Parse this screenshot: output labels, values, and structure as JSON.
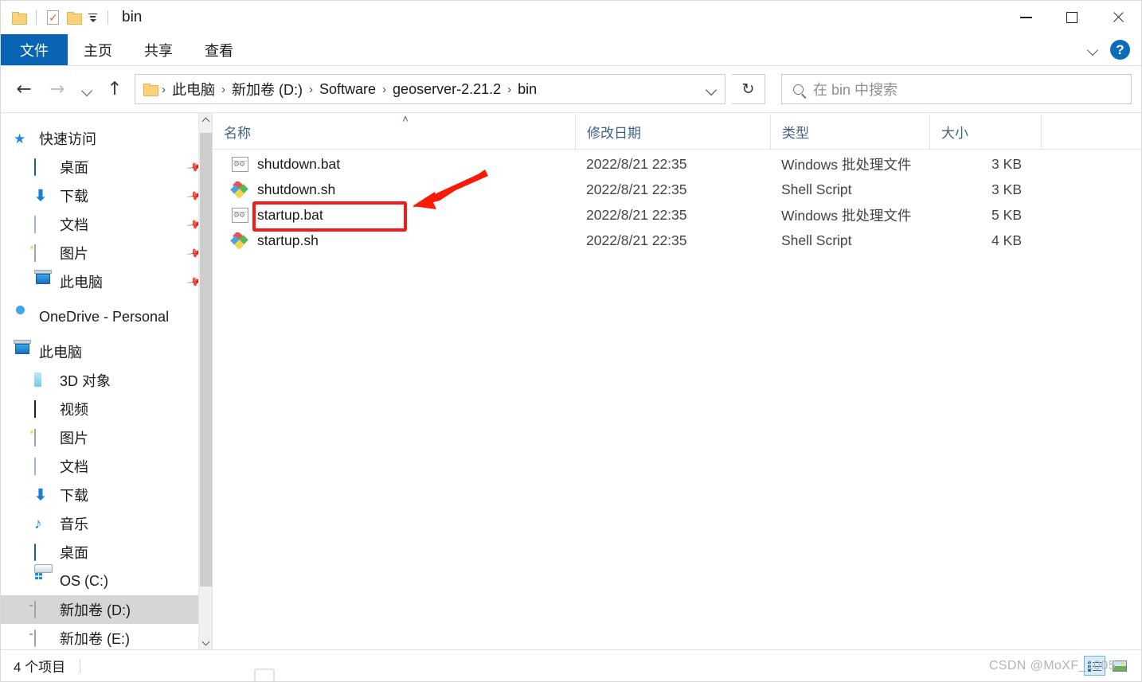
{
  "window": {
    "title": "bin",
    "quick_access_toolbar": [
      "folder-icon",
      "properties-icon",
      "new-folder-icon",
      "customize-dropdown"
    ],
    "controls": {
      "minimize": "—",
      "maximize": "□",
      "close": "✕"
    }
  },
  "ribbon": {
    "tabs": [
      {
        "label": "文件",
        "active": true
      },
      {
        "label": "主页",
        "active": false
      },
      {
        "label": "共享",
        "active": false
      },
      {
        "label": "查看",
        "active": false
      }
    ],
    "expand_label": "chevron-down-icon",
    "help_label": "?"
  },
  "addressbar": {
    "back": "←",
    "forward": "→",
    "recent": "chevron-down-icon",
    "up": "↑",
    "refresh": "↻",
    "breadcrumbs": [
      "此电脑",
      "新加卷 (D:)",
      "Software",
      "geoserver-2.21.2",
      "bin"
    ],
    "separator": "›"
  },
  "search": {
    "placeholder": "在 bin 中搜索",
    "value": ""
  },
  "sidebar": {
    "items": [
      {
        "label": "快速访问",
        "icon": "star-icon",
        "level": "root",
        "pinned": false,
        "selected": false
      },
      {
        "label": "桌面",
        "icon": "desktop-icon",
        "level": "child",
        "pinned": true,
        "selected": false
      },
      {
        "label": "下载",
        "icon": "downloads-icon",
        "level": "child",
        "pinned": true,
        "selected": false
      },
      {
        "label": "文档",
        "icon": "documents-icon",
        "level": "child",
        "pinned": true,
        "selected": false
      },
      {
        "label": "图片",
        "icon": "pictures-icon",
        "level": "child",
        "pinned": true,
        "selected": false
      },
      {
        "label": "此电脑",
        "icon": "this-pc-icon",
        "level": "child",
        "pinned": true,
        "selected": false
      },
      {
        "label": "OneDrive - Personal",
        "icon": "onedrive-icon",
        "level": "root",
        "pinned": false,
        "selected": false
      },
      {
        "label": "此电脑",
        "icon": "this-pc-icon",
        "level": "root",
        "pinned": false,
        "selected": false
      },
      {
        "label": "3D 对象",
        "icon": "3d-objects-icon",
        "level": "child",
        "pinned": false,
        "selected": false
      },
      {
        "label": "视频",
        "icon": "videos-icon",
        "level": "child",
        "pinned": false,
        "selected": false
      },
      {
        "label": "图片",
        "icon": "pictures-icon",
        "level": "child",
        "pinned": false,
        "selected": false
      },
      {
        "label": "文档",
        "icon": "documents-icon",
        "level": "child",
        "pinned": false,
        "selected": false
      },
      {
        "label": "下载",
        "icon": "downloads-icon",
        "level": "child",
        "pinned": false,
        "selected": false
      },
      {
        "label": "音乐",
        "icon": "music-icon",
        "level": "child",
        "pinned": false,
        "selected": false
      },
      {
        "label": "桌面",
        "icon": "desktop-icon",
        "level": "child",
        "pinned": false,
        "selected": false
      },
      {
        "label": "OS (C:)",
        "icon": "os-drive-icon",
        "level": "child",
        "pinned": false,
        "selected": false
      },
      {
        "label": "新加卷 (D:)",
        "icon": "drive-icon",
        "level": "child",
        "pinned": false,
        "selected": true
      },
      {
        "label": "新加卷 (E:)",
        "icon": "drive-icon",
        "level": "child",
        "pinned": false,
        "selected": false
      }
    ]
  },
  "filelist": {
    "columns": [
      {
        "key": "name",
        "label": "名称",
        "sorted": "asc"
      },
      {
        "key": "date",
        "label": "修改日期",
        "sorted": ""
      },
      {
        "key": "type",
        "label": "类型",
        "sorted": ""
      },
      {
        "key": "size",
        "label": "大小",
        "sorted": ""
      }
    ],
    "sort_caret": "˄",
    "rows": [
      {
        "name": "shutdown.bat",
        "icon": "bat-file-icon",
        "date": "2022/8/21 22:35",
        "type": "Windows 批处理文件",
        "size": "3 KB",
        "highlighted": false
      },
      {
        "name": "shutdown.sh",
        "icon": "sh-file-icon",
        "date": "2022/8/21 22:35",
        "type": "Shell Script",
        "size": "3 KB",
        "highlighted": false
      },
      {
        "name": "startup.bat",
        "icon": "bat-file-icon",
        "date": "2022/8/21 22:35",
        "type": "Windows 批处理文件",
        "size": "5 KB",
        "highlighted": true
      },
      {
        "name": "startup.sh",
        "icon": "sh-file-icon",
        "date": "2022/8/21 22:35",
        "type": "Shell Script",
        "size": "4 KB",
        "highlighted": false
      }
    ]
  },
  "annotation": {
    "highlight_color": "#ef1c1c",
    "target": "startup.bat",
    "arrow": "red-arrow-pointing-to-startup-bat"
  },
  "statusbar": {
    "item_count": "4 个项目",
    "views": [
      {
        "name": "details-view",
        "active": true
      },
      {
        "name": "thumbnails-view",
        "active": false
      }
    ]
  },
  "watermark": {
    "text": "CSDN @MoXF_1005"
  }
}
